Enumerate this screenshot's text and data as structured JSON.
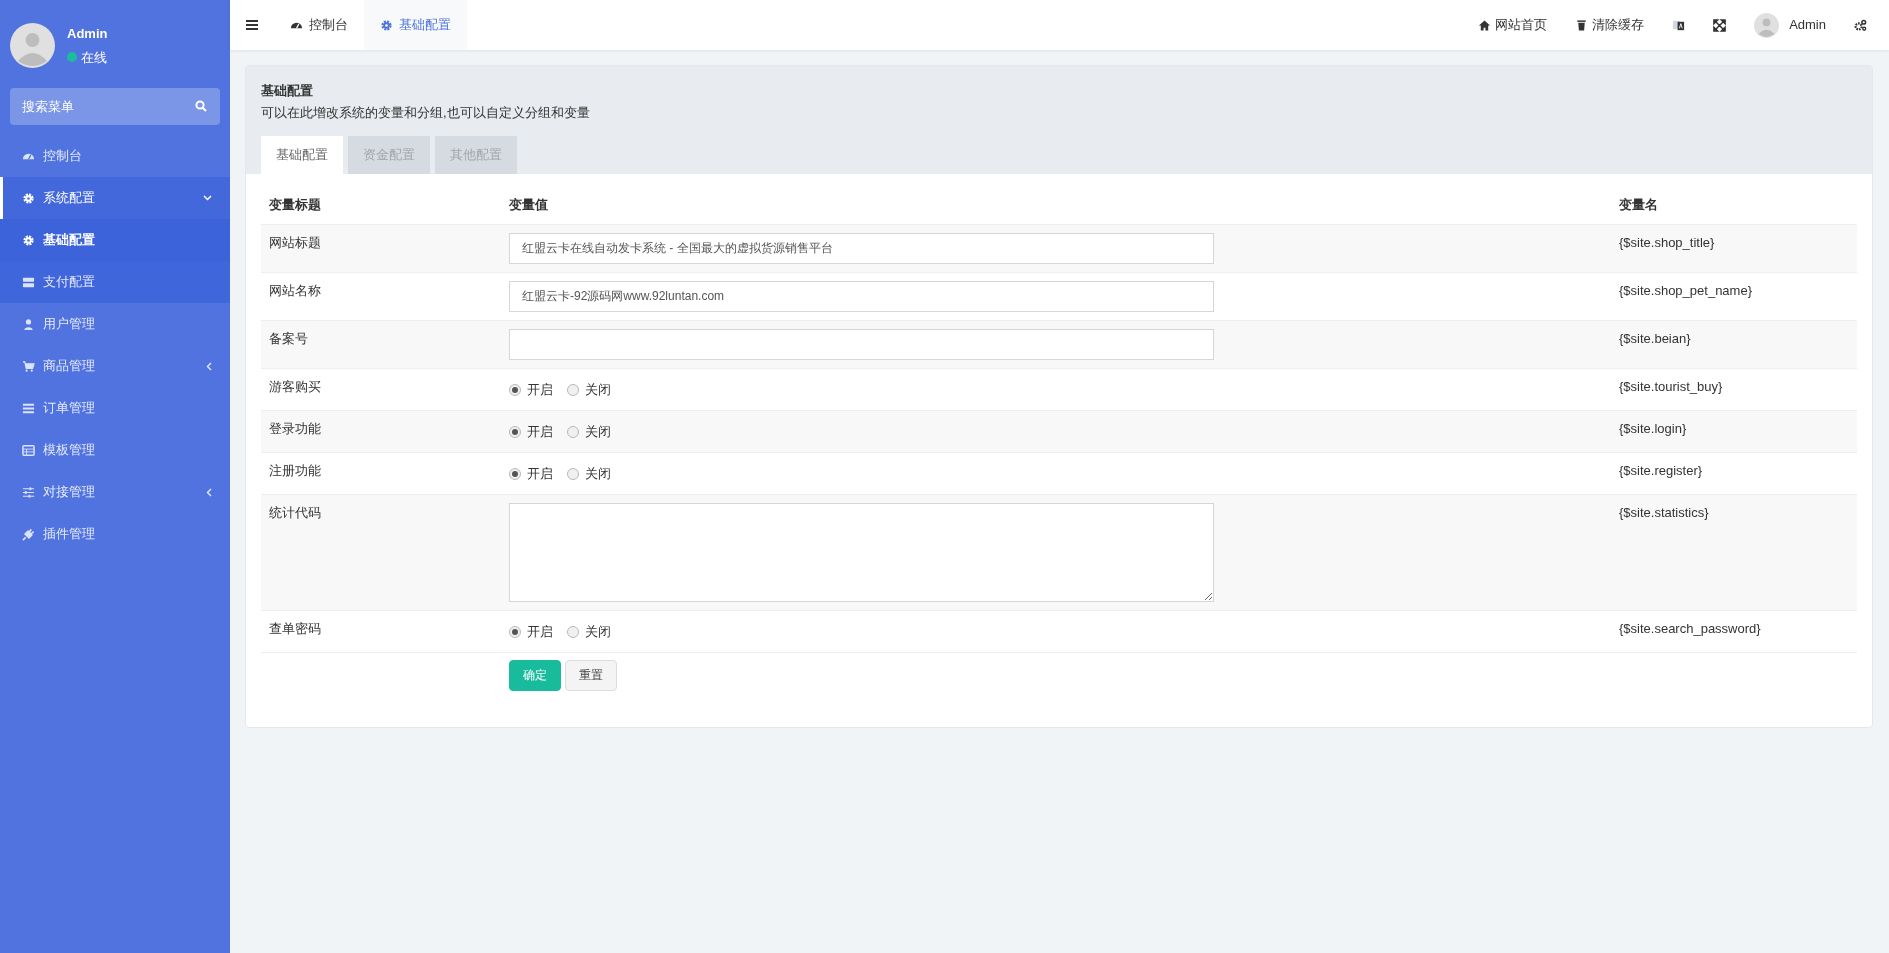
{
  "sidebar": {
    "user": {
      "name": "Admin",
      "status": "在线"
    },
    "search": {
      "placeholder": "搜索菜单"
    },
    "items": [
      {
        "label": "控制台",
        "kind": "dashboard",
        "selected": false
      },
      {
        "label": "系统配置",
        "kind": "gear",
        "selected": false,
        "expanded": true,
        "children": [
          {
            "label": "基础配置",
            "kind": "gear",
            "selected": true
          },
          {
            "label": "支付配置",
            "kind": "server",
            "selected": false
          }
        ]
      },
      {
        "label": "用户管理",
        "kind": "user",
        "selected": false
      },
      {
        "label": "商品管理",
        "kind": "cart",
        "selected": false,
        "expanded": false
      },
      {
        "label": "订单管理",
        "kind": "list",
        "selected": false
      },
      {
        "label": "模板管理",
        "kind": "table",
        "selected": false
      },
      {
        "label": "对接管理",
        "kind": "sliders",
        "selected": false,
        "expanded": false
      },
      {
        "label": "插件管理",
        "kind": "plug",
        "selected": false
      }
    ]
  },
  "topbar": {
    "tabs": [
      {
        "label": "控制台",
        "kind": "dashboard",
        "selected": false
      },
      {
        "label": "基础配置",
        "kind": "gear",
        "selected": true
      }
    ],
    "links": [
      {
        "kind": "home",
        "label": "网站首页"
      },
      {
        "kind": "trash",
        "label": "清除缓存"
      },
      {
        "kind": "translate"
      },
      {
        "kind": "expand"
      },
      {
        "kind": "user",
        "label": "Admin"
      },
      {
        "kind": "gears"
      }
    ]
  },
  "panel": {
    "title": "基础配置",
    "subtitle": "可以在此增改系统的变量和分组,也可以自定义分组和变量",
    "tabs": [
      {
        "label": "基础配置",
        "selected": true
      },
      {
        "label": "资金配置",
        "selected": false
      },
      {
        "label": "其他配置",
        "selected": false
      }
    ],
    "columns": [
      "变量标题",
      "变量值",
      "变量名"
    ],
    "rows": [
      {
        "kind": "text",
        "label": "网站标题",
        "value": "红盟云卡在线自动发卡系统 - 全国最大的虚拟货源销售平台",
        "var": "{$site.shop_title}"
      },
      {
        "kind": "text",
        "label": "网站名称",
        "value": "红盟云卡-92源码网www.92luntan.com",
        "var": "{$site.shop_pet_name}"
      },
      {
        "kind": "text",
        "label": "备案号",
        "var": "{$site.beian}"
      },
      {
        "kind": "radio",
        "label": "游客购买",
        "options": [
          {
            "label": "开启",
            "selected": true
          },
          {
            "label": "关闭",
            "selected": false
          }
        ],
        "var": "{$site.tourist_buy}"
      },
      {
        "kind": "radio",
        "label": "登录功能",
        "options": [
          {
            "label": "开启",
            "selected": true
          },
          {
            "label": "关闭",
            "selected": false
          }
        ],
        "var": "{$site.login}"
      },
      {
        "kind": "radio",
        "label": "注册功能",
        "options": [
          {
            "label": "开启",
            "selected": true
          },
          {
            "label": "关闭",
            "selected": false
          }
        ],
        "var": "{$site.register}"
      },
      {
        "kind": "textarea",
        "label": "统计代码",
        "var": "{$site.statistics}"
      },
      {
        "kind": "radio",
        "label": "查单密码",
        "options": [
          {
            "label": "开启",
            "selected": true
          },
          {
            "label": "关闭",
            "selected": false
          }
        ],
        "var": "{$site.search_password}"
      }
    ],
    "buttons": [
      {
        "kind": "primary",
        "label": "确定"
      },
      {
        "kind": "default",
        "label": "重置"
      }
    ]
  }
}
